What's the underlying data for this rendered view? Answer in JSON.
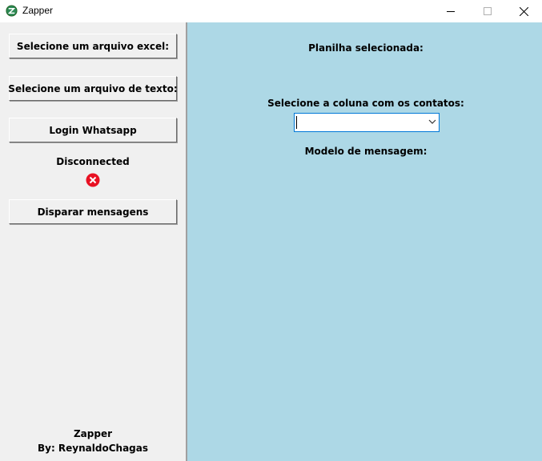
{
  "window": {
    "title": "Zapper",
    "icon": "zapper-app-icon",
    "controls": [
      "minimize-icon",
      "maximize-icon",
      "close-icon"
    ]
  },
  "sidebar": {
    "select_excel_label": "Selecione um arquivo excel:",
    "select_text_label": "Selecione um arquivo de texto:",
    "login_label": "Login Whatsapp",
    "status_text": "Disconnected",
    "status_icon": "error-icon",
    "send_label": "Disparar mensagens",
    "footer_app": "Zapper",
    "footer_author": "By: ReynaldoChagas"
  },
  "main": {
    "sheet_label": "Planilha selecionada:",
    "column_label": "Selecione a coluna com os contatos:",
    "column_value": "",
    "message_label": "Modelo de mensagem:"
  },
  "colors": {
    "sidebar_bg": "#f0f0f0",
    "main_bg": "#add8e6",
    "status_error": "#e81123",
    "focus_border": "#0078d7"
  }
}
